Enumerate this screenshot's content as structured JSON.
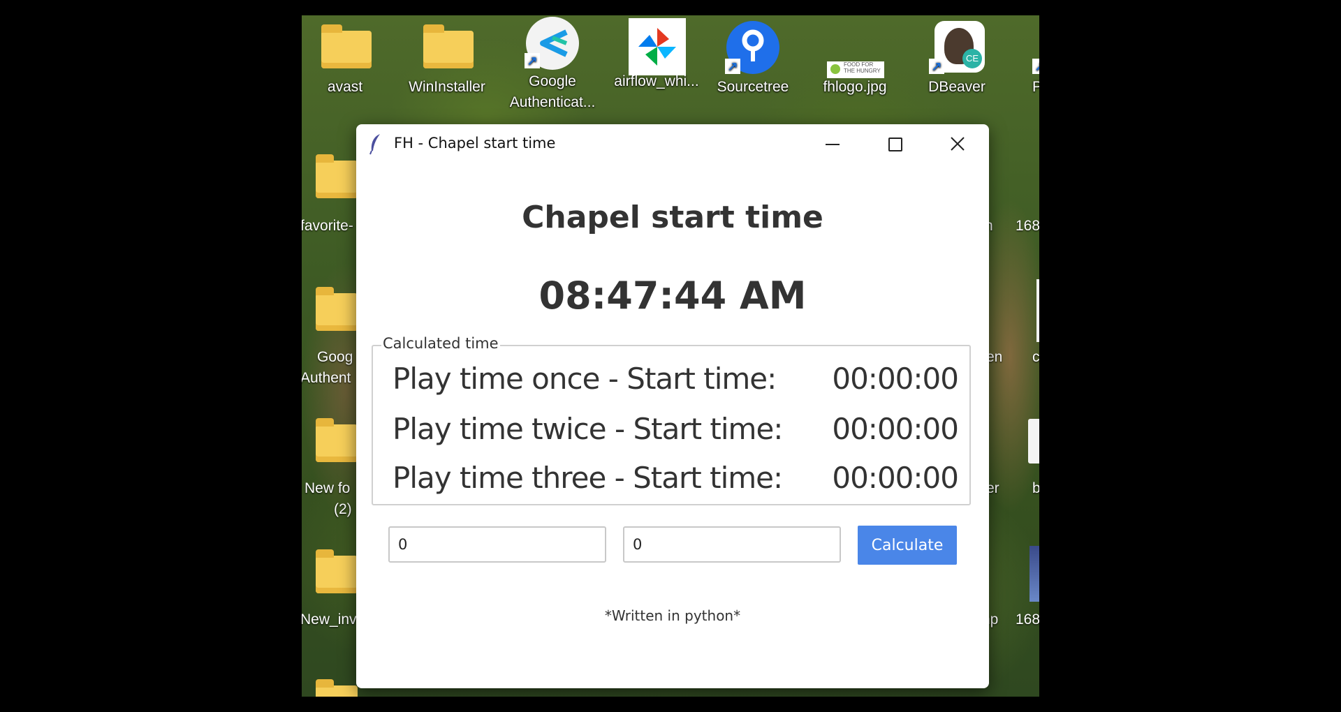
{
  "desktop": {
    "icons": [
      {
        "label": "avast"
      },
      {
        "label": "WinInstaller"
      },
      {
        "label": "Google Authenticat..."
      },
      {
        "label": "airflow_whi..."
      },
      {
        "label": "Sourcetree"
      },
      {
        "label": "fhlogo.jpg"
      },
      {
        "label": "DBeaver"
      },
      {
        "label": "P"
      }
    ],
    "fhlogo_text": "FOOD FOR THE HUNGRY",
    "dbeaver_badge": "CE",
    "left_partial": [
      "favorite-",
      "Goog",
      "Authent",
      "New fo",
      "(2)",
      "New_inv"
    ],
    "right_partial": [
      "n",
      "168",
      "en",
      "c",
      "er",
      "b",
      "np",
      "168"
    ]
  },
  "window": {
    "title": "FH - Chapel start time",
    "controls": {
      "minimize": "minimize",
      "maximize": "maximize",
      "close": "✕"
    },
    "heading": "Chapel start time",
    "clock": "08:47:44 AM",
    "group_label": "Calculated time",
    "rows": [
      {
        "label": "Play time once - Start time:",
        "value": "00:00:00"
      },
      {
        "label": "Play time twice - Start time:",
        "value": "00:00:00"
      },
      {
        "label": "Play time three - Start time:",
        "value": "00:00:00"
      }
    ],
    "inputs": [
      {
        "value": "0"
      },
      {
        "value": "0"
      }
    ],
    "calculate_label": "Calculate",
    "footer": "*Written in python*"
  },
  "colors": {
    "accent": "#4a86e8",
    "folder": "#f6cf5a"
  }
}
